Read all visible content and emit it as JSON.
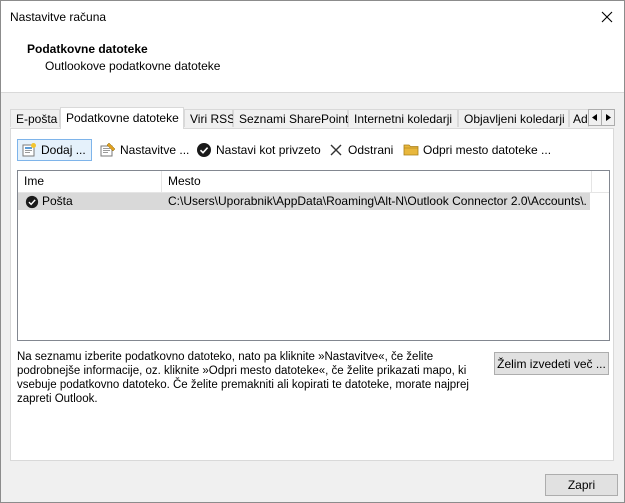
{
  "window": {
    "title": "Nastavitve računa"
  },
  "header": {
    "title": "Podatkovne datoteke",
    "subtitle": "Outlookove podatkovne datoteke"
  },
  "tabs": [
    {
      "label": "E-pošta",
      "active": false
    },
    {
      "label": "Podatkovne datoteke",
      "active": true
    },
    {
      "label": "Viri RSS",
      "active": false
    },
    {
      "label": "Seznami SharePoint",
      "active": false
    },
    {
      "label": "Internetni koledarji",
      "active": false
    },
    {
      "label": "Objavljeni koledarji",
      "active": false
    },
    {
      "label": "Ad",
      "active": false
    }
  ],
  "toolbar": {
    "add_label": "Dodaj ...",
    "settings_label": "Nastavitve ...",
    "default_label": "Nastavi kot privzeto",
    "remove_label": "Odstrani",
    "open_label": "Odpri mesto datoteke ..."
  },
  "list": {
    "columns": {
      "name": "Ime",
      "location": "Mesto"
    },
    "rows": [
      {
        "name": "Pošta",
        "location": "C:\\Users\\Uporabnik\\AppData\\Roaming\\Alt-N\\Outlook Connector 2.0\\Accounts\\..."
      }
    ]
  },
  "description": "Na seznamu izberite podatkovno datoteko, nato pa kliknite »Nastavitve«, če želite podrobnejše informacije, oz. kliknite »Odpri mesto datoteke«, če želite prikazati mapo, ki vsebuje podatkovno datoteko. Če želite premakniti ali kopirati te datoteke, morate najprej zapreti Outlook.",
  "learn_more_label": "Želim izvedeti več ...",
  "close_label": "Zapri",
  "colors": {
    "selected_row": "#d9d9d9",
    "hover_border": "#7eb4ea",
    "hover_fill": "#e5f1fb",
    "folder": "#e8b73c"
  }
}
